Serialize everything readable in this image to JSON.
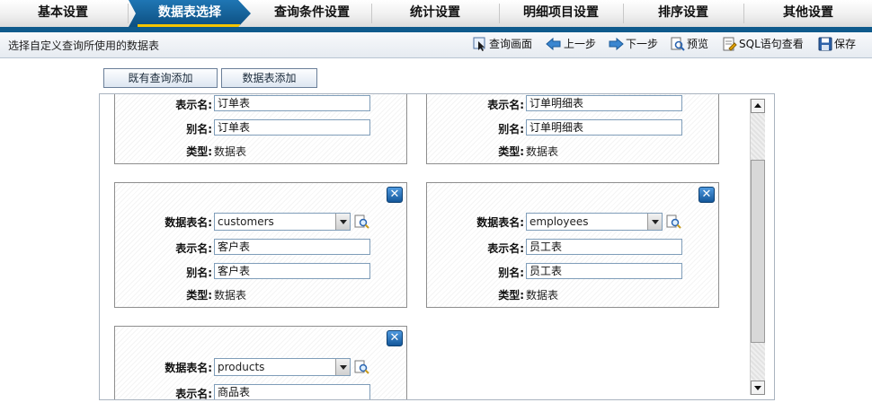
{
  "tabs": [
    "基本设置",
    "数据表选择",
    "查询条件设置",
    "统计设置",
    "明细项目设置",
    "排序设置",
    "其他设置"
  ],
  "toolbar": {
    "hint": "选择自定义查询所使用的数据表",
    "query_screen": "查询画面",
    "prev": "上一步",
    "next": "下一步",
    "preview": "预览",
    "sql_view": "SQL语句查看",
    "save": "保存"
  },
  "buttons": {
    "add_existing": "既有查询添加",
    "add_table": "数据表添加"
  },
  "labels": {
    "table_name": "数据表名:",
    "display_name": "表示名:",
    "alias": "别名:",
    "type": "类型:",
    "close": "✕"
  },
  "cards": [
    {
      "display": "订单表",
      "alias": "订单表",
      "type": "数据表"
    },
    {
      "display": "订单明细表",
      "alias": "订单明细表",
      "type": "数据表"
    },
    {
      "table": "customers",
      "display": "客户表",
      "alias": "客户表",
      "type": "数据表"
    },
    {
      "table": "employees",
      "display": "员工表",
      "alias": "员工表",
      "type": "数据表"
    },
    {
      "table": "products",
      "display": "商品表"
    }
  ],
  "colors": {
    "accent": "#0f5a8c",
    "active_tab": "#1f76b4",
    "highlight": "#f5c400"
  }
}
